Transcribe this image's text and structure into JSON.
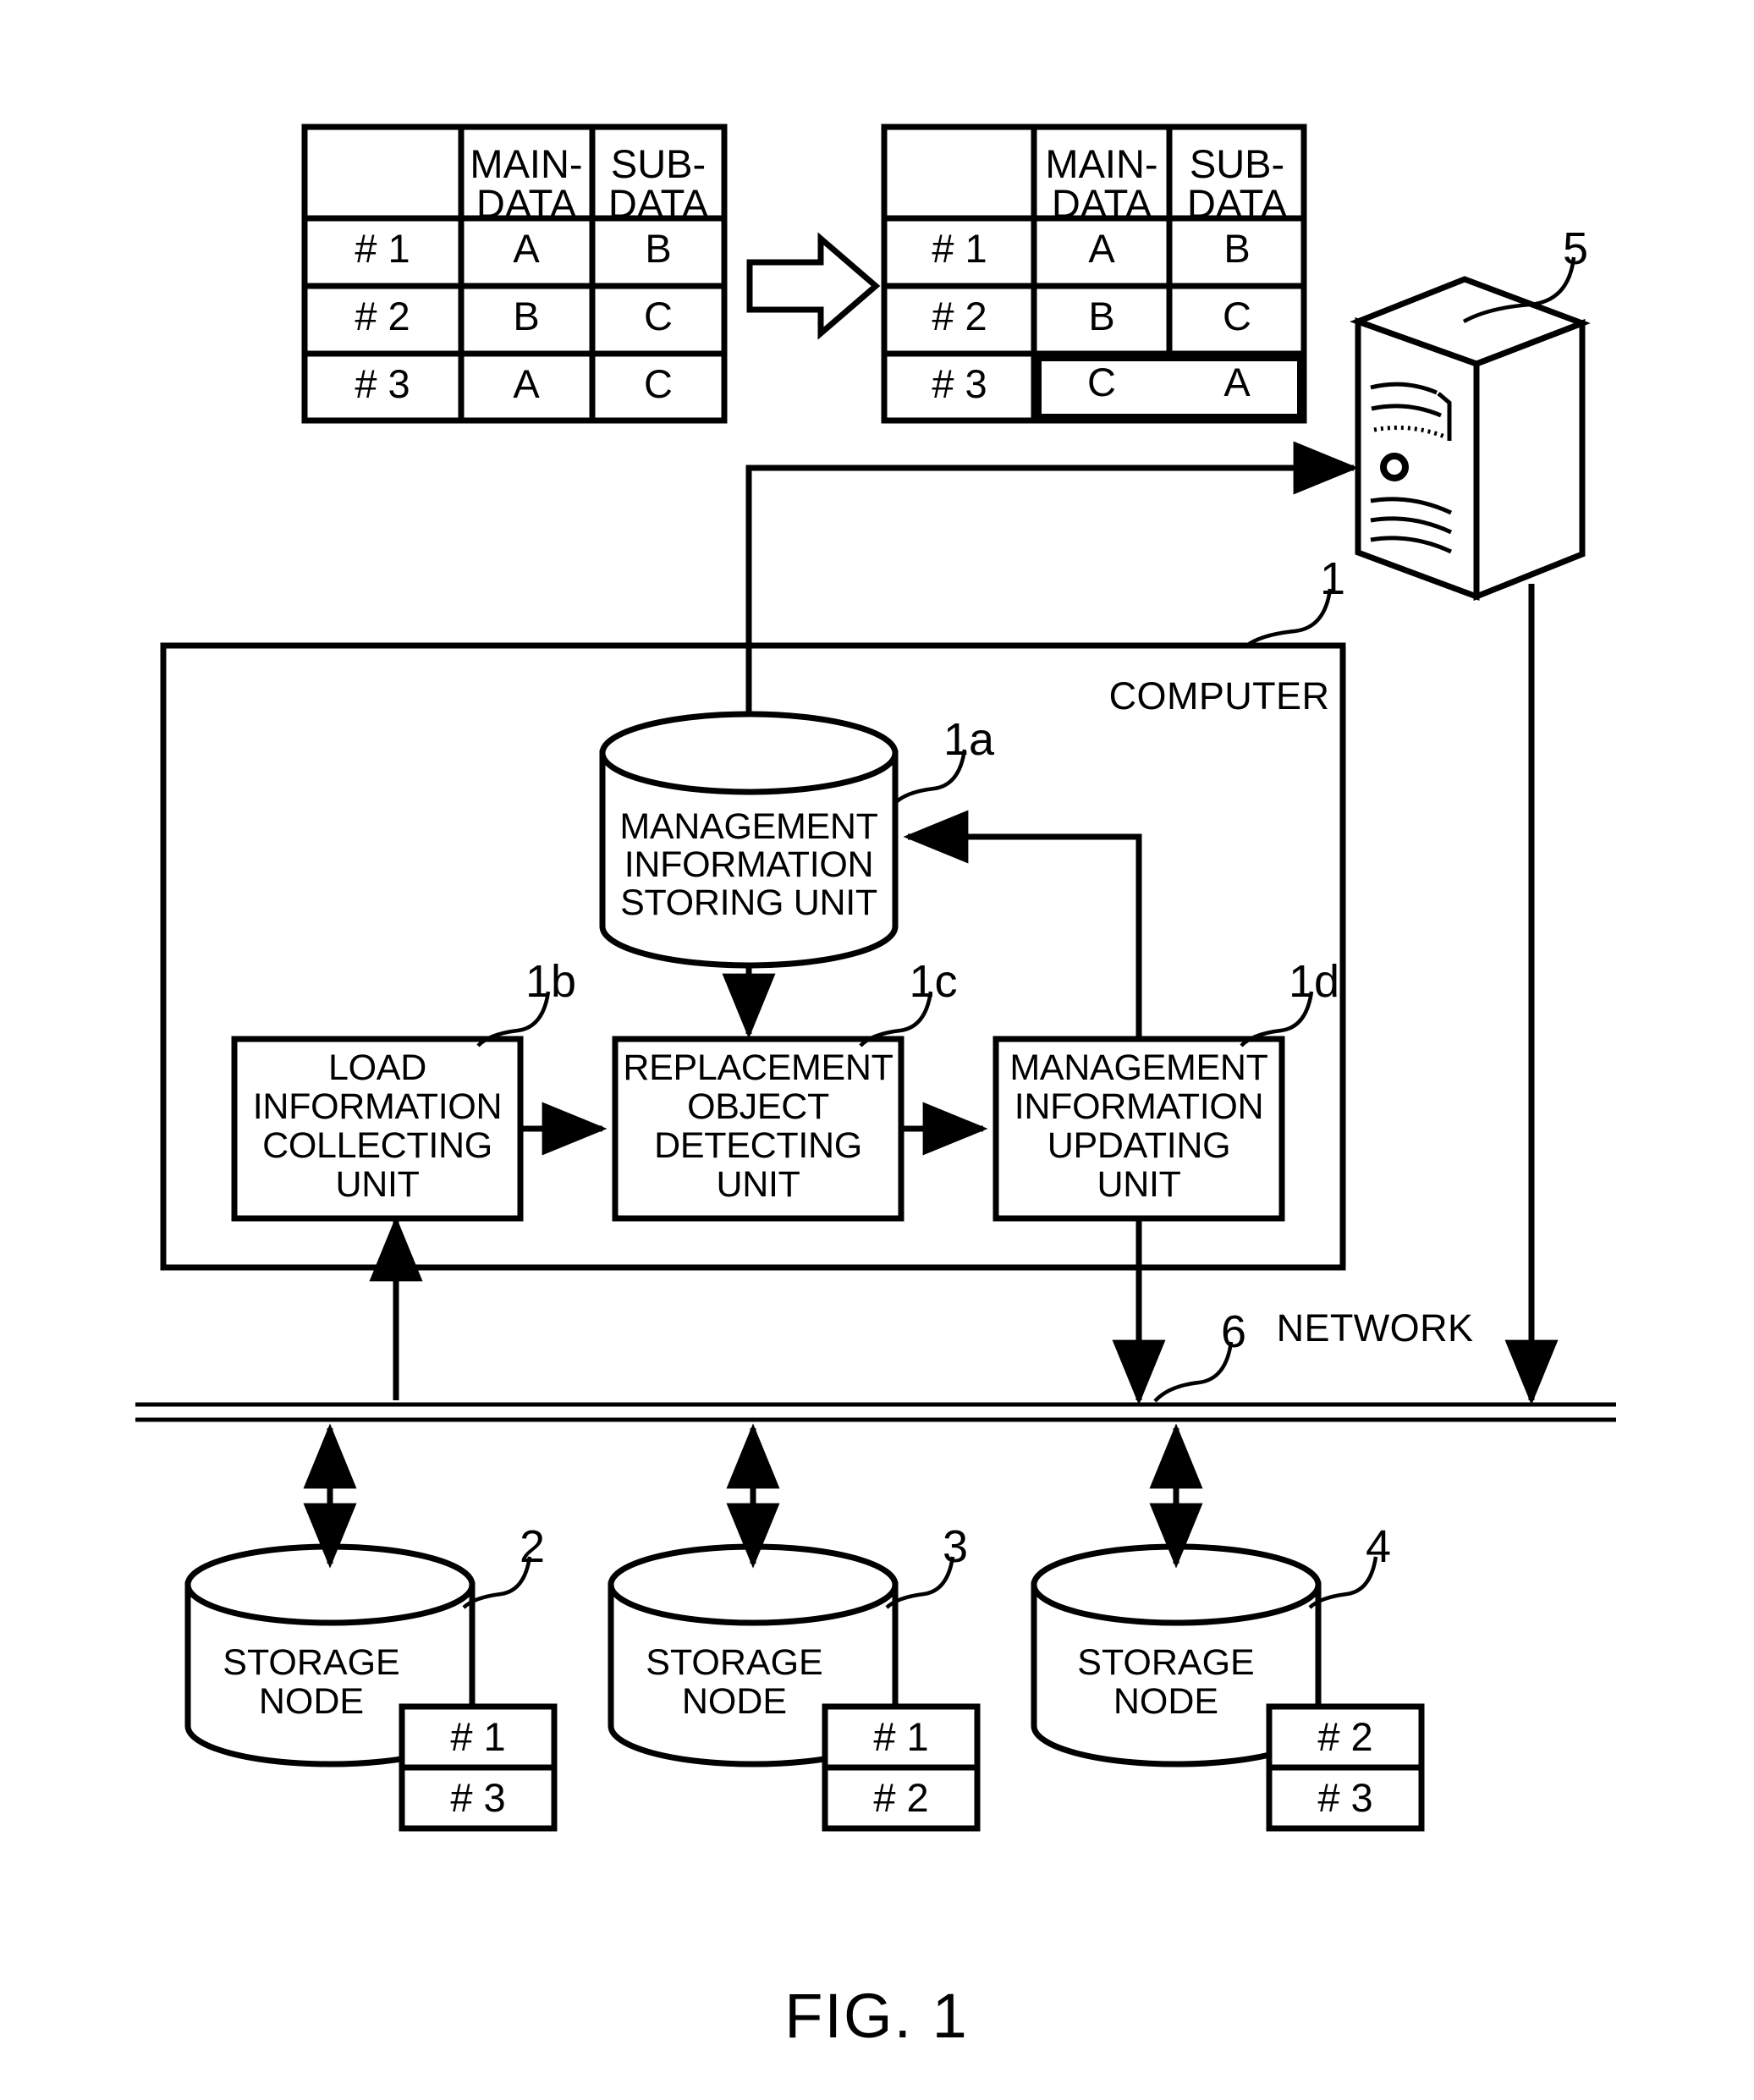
{
  "figure": {
    "caption": "FIG. 1",
    "title": "Storage system management diagram"
  },
  "tables": {
    "before": {
      "name": "management-table-before",
      "headers": [
        "",
        "MAIN-\nDATA",
        "SUB-\nDATA"
      ],
      "rows": [
        {
          "id": "# 1",
          "main": "A",
          "sub": "B",
          "highlight": false
        },
        {
          "id": "# 2",
          "main": "B",
          "sub": "C",
          "highlight": false
        },
        {
          "id": "# 3",
          "main": "A",
          "sub": "C",
          "highlight": false
        }
      ]
    },
    "after": {
      "name": "management-table-after",
      "headers": [
        "",
        "MAIN-\nDATA",
        "SUB-\nDATA"
      ],
      "rows": [
        {
          "id": "# 1",
          "main": "A",
          "sub": "B",
          "highlight": false
        },
        {
          "id": "# 2",
          "main": "B",
          "sub": "C",
          "highlight": false
        },
        {
          "id": "# 3",
          "main": "C",
          "sub": "A",
          "highlight": true
        }
      ]
    },
    "transform_arrow": "block-arrow-right"
  },
  "client": {
    "ref": "5",
    "icon": "server-tower-icon"
  },
  "computer": {
    "ref": "1",
    "label": "COMPUTER",
    "storing_unit": {
      "ref": "1a",
      "label": "MANAGEMENT\nINFORMATION\nSTORING UNIT",
      "line1": "MANAGEMENT",
      "line2": "INFORMATION",
      "line3": "STORING UNIT"
    },
    "units": [
      {
        "ref": "1b",
        "name": "load-information-collecting-unit",
        "line1": "LOAD",
        "line2": "INFORMATION",
        "line3": "COLLECTING",
        "line4": "UNIT"
      },
      {
        "ref": "1c",
        "name": "replacement-object-detecting-unit",
        "line1": "REPLACEMENT",
        "line2": "OBJECT",
        "line3": "DETECTING",
        "line4": "UNIT"
      },
      {
        "ref": "1d",
        "name": "management-information-updating-unit",
        "line1": "MANAGEMENT",
        "line2": "INFORMATION",
        "line3": "UPDATING",
        "line4": "UNIT"
      }
    ]
  },
  "network": {
    "ref": "6",
    "label": "NETWORK"
  },
  "storage_nodes": [
    {
      "ref": "2",
      "line1": "STORAGE",
      "line2": "NODE",
      "slots": [
        "# 1",
        "# 3"
      ]
    },
    {
      "ref": "3",
      "line1": "STORAGE",
      "line2": "NODE",
      "slots": [
        "# 1",
        "# 2"
      ]
    },
    {
      "ref": "4",
      "line1": "STORAGE",
      "line2": "NODE",
      "slots": [
        "# 2",
        "# 3"
      ]
    }
  ],
  "colors": {
    "ink": "#000000",
    "paper": "#ffffff"
  }
}
